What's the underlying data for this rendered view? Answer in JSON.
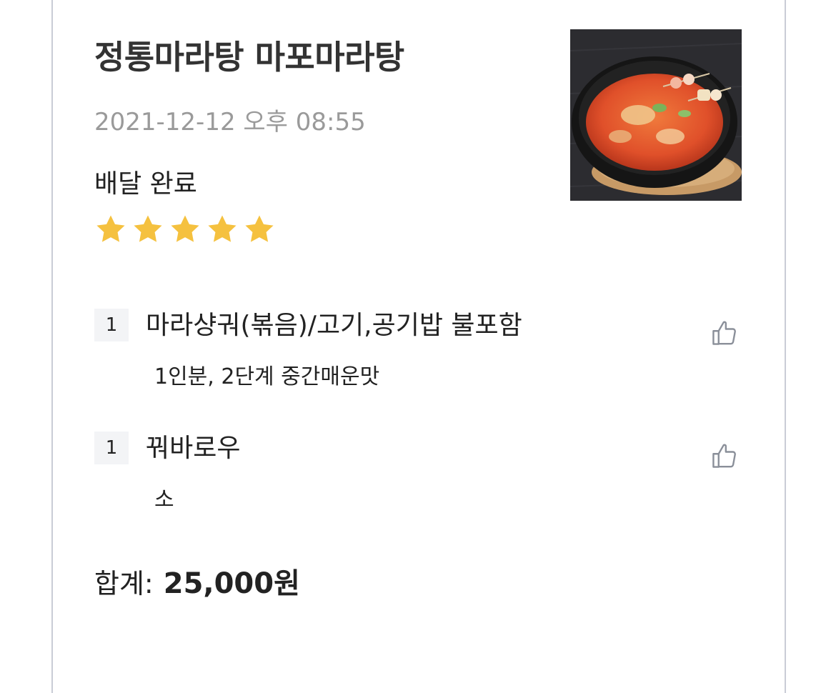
{
  "order": {
    "store_name": "정통마라탕 마포마라탕",
    "datetime": "2021-12-12 오후 08:55",
    "status": "배달 완료",
    "rating": 5,
    "rating_max": 5,
    "star_color": "#F5C13F",
    "image_icon": "malatang-bowl-photo"
  },
  "items": [
    {
      "quantity": "1",
      "name": "마라샹궈(볶음)/고기,공기밥 불포함",
      "options": "1인분, 2단계 중간매운맛",
      "like_icon": "thumbs-up-icon"
    },
    {
      "quantity": "1",
      "name": "꿔바로우",
      "options": "소",
      "like_icon": "thumbs-up-icon"
    }
  ],
  "total": {
    "label": "합계:",
    "amount": "25,000원"
  }
}
